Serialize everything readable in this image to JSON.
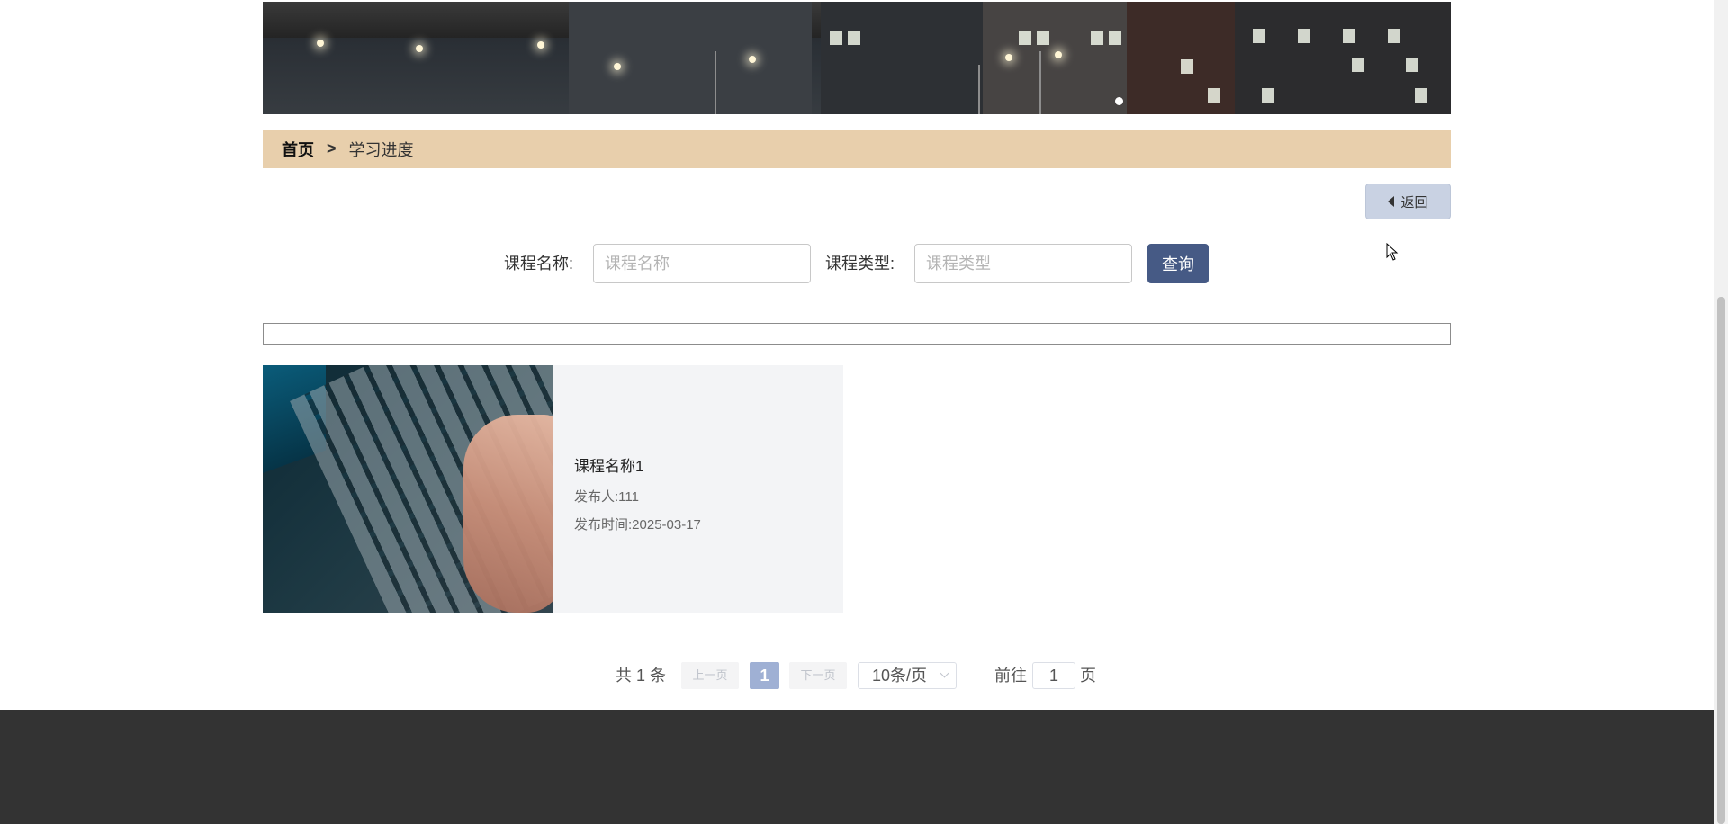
{
  "breadcrumb": {
    "home": "首页",
    "separator": ">",
    "current": "学习进度"
  },
  "back_button": {
    "label": "返回",
    "icon": "caret-left-icon"
  },
  "search": {
    "course_name_label": "课程名称:",
    "course_name_placeholder": "课程名称",
    "course_name_value": "",
    "course_type_label": "课程类型:",
    "course_type_placeholder": "课程类型",
    "course_type_value": "",
    "query_label": "查询"
  },
  "courses": [
    {
      "title": "课程名称1",
      "publisher": "发布人:111",
      "publish_time": "发布时间:2025-03-17"
    }
  ],
  "pagination": {
    "total": "共 1 条",
    "prev": "上一页",
    "current_page": "1",
    "next": "下一页",
    "page_size": "10条/页",
    "goto_prefix": "前往",
    "goto_value": "1",
    "goto_suffix": "页"
  },
  "colors": {
    "breadcrumb_bg": "#e8cfac",
    "query_button_bg": "#465a85",
    "back_button_bg": "#c9d2e3",
    "active_page_bg": "#9fb0d4",
    "footer_bg": "#333333",
    "card_bg": "#f3f4f6"
  }
}
